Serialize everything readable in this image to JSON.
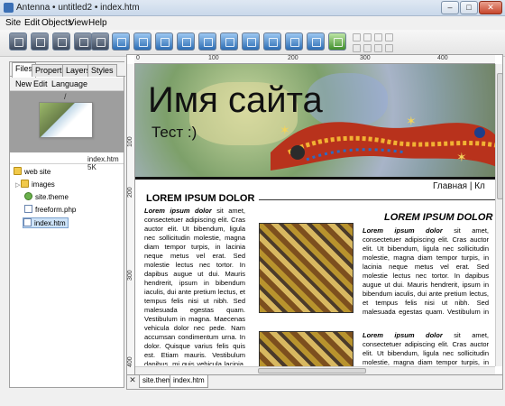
{
  "window": {
    "title": "Antenna • untitled2 • index.htm",
    "min": "–",
    "max": "□",
    "close": "✕"
  },
  "menu": [
    "Site",
    "Edit",
    "Objects",
    "View",
    "Help"
  ],
  "left_panel": {
    "tabs": [
      "Files",
      "Properties",
      "Layers",
      "Styles"
    ],
    "menu": [
      "New",
      "Edit",
      "Language"
    ],
    "path": "/",
    "preview_label": "index.htm 5K",
    "tree": {
      "root": "web site",
      "items": [
        "images",
        "site.theme",
        "freeform.php",
        "index.htm"
      ]
    }
  },
  "ruler": {
    "top": [
      "0",
      "100",
      "200",
      "300",
      "400"
    ],
    "left": [
      "100",
      "200",
      "300",
      "400"
    ]
  },
  "page": {
    "site_name": "Имя сайта",
    "site_sub": "Тест :)",
    "nav": "Главная | Кл",
    "col1_title": "LOREM IPSUM DOLOR",
    "col1_text_lead": "Lorem ipsum dolor",
    "col1_text": " sit amet, consectetuer adipiscing elit. Cras auctor elit. Ut bibendum, ligula nec sollicitudin molestie, magna diam tempor turpis, in lacinia neque metus vel erat. Sed molestie lectus nec tortor. In dapibus augue ut dui. Mauris hendrerit, ipsum in bibendum iaculis, dui ante pretium lectus, et tempus felis nisi ut nibh. Sed malesuada egestas quam. Vestibulum in magna. Maecenas vehicula dolor nec pede. Nam accumsan condimentum urna. In dolor. Quisque varius felis quis est. Etiam mauris. Vestibulum dapibus, mi quis vehicula lacinia, augue augue nonummy ante, vitae tincidunt massa dolor quis nibh. Quisque",
    "col2_title": "LOREM IPSUM DOLOR",
    "col2_text_lead": "Lorem ipsum dolor",
    "col2_text": " sit amet, consectetuer adipiscing elit. Cras auctor elit. Ut bibendum, ligula nec sollicitudin molestie, magna diam tempor turpis, in lacinia neque metus vel erat. Sed molestie lectus nec tortor. In dapibus augue ut dui. Mauris hendrerit, ipsum in bibendum iaculis, dui ante pretium lectus, et tempus felis nisi ut nibh. Sed malesuada egestas quam. Vestibulum in magna. Maecenas vehicula dolor nec pede. Nam accumsan condimentum urna. In dolor. Quisque varius felis quis est. Etiam mauris. Vestibulum dapibus, mi quis vehicula lacinia, augue augue nonummy ante, vitae tincidunt massa dolor quis nibh.",
    "col2_text2_lead": "Lorem ipsum dolor",
    "col2_text2": " sit amet, consectetuer adipiscing elit. Cras auctor elit. Ut bibendum, ligula nec sollicitudin molestie, magna diam tempor turpis, in lacinia neque metus vel erat. Sed molestie lectus nec tortor. In dapibus augue ut dui."
  },
  "bottom_tabs": [
    "site.theme",
    "index.htm"
  ],
  "close_tab": "✕"
}
